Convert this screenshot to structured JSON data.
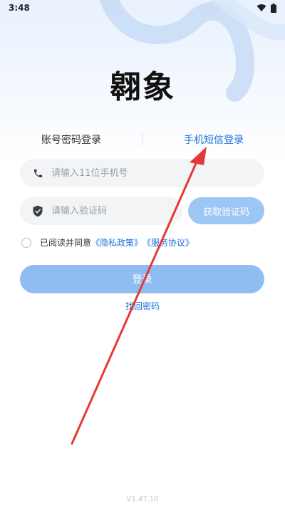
{
  "status_bar": {
    "time": "3:48"
  },
  "app": {
    "logo_text": "翱象"
  },
  "tabs": [
    {
      "label": "账号密码登录",
      "active": false
    },
    {
      "label": "手机短信登录",
      "active": true
    }
  ],
  "phone_field": {
    "placeholder": "请输入11位手机号",
    "value": ""
  },
  "code_field": {
    "placeholder": "请输入验证码",
    "value": ""
  },
  "get_code_button": "获取验证码",
  "agreement": {
    "prefix": "已阅读并同意",
    "privacy_link": "《隐私政策》",
    "service_link": "《服务协议》",
    "checked": false
  },
  "login_button": "登录",
  "forgot_password_link": "找回密码",
  "version": "V1.47.10",
  "colors": {
    "accent": "#1a73d9",
    "button_disabled": "#8fbdf2",
    "field_bg": "#f3f4f6",
    "annotation_arrow": "#e53935"
  },
  "icons": [
    "wifi-icon",
    "battery-icon",
    "phone-icon",
    "shield-check-icon"
  ]
}
